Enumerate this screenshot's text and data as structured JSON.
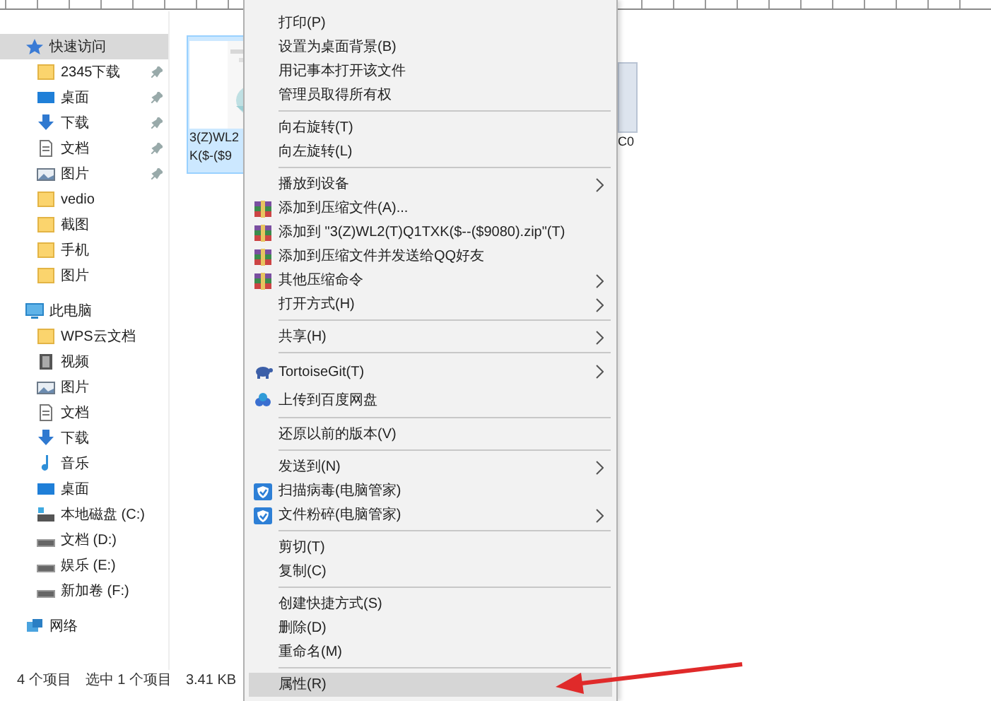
{
  "sidebar": {
    "items": [
      {
        "label": "快速访问",
        "kind": "star",
        "selected": true,
        "children": [
          {
            "label": "2345下载",
            "kind": "folder",
            "selected": false,
            "pinned": true
          },
          {
            "label": "桌面",
            "kind": "desktop",
            "selected": false,
            "pinned": true
          },
          {
            "label": "下载",
            "kind": "download",
            "selected": false,
            "pinned": true
          },
          {
            "label": "文档",
            "kind": "document",
            "selected": false,
            "pinned": true
          },
          {
            "label": "图片",
            "kind": "pictures",
            "selected": false,
            "pinned": true
          },
          {
            "label": "vedio",
            "kind": "folder",
            "selected": false,
            "pinned": false
          },
          {
            "label": "截图",
            "kind": "folder",
            "selected": false,
            "pinned": false
          },
          {
            "label": "手机",
            "kind": "folder",
            "selected": false,
            "pinned": false
          },
          {
            "label": "图片",
            "kind": "folder",
            "selected": false,
            "pinned": false
          }
        ]
      },
      {
        "label": "此电脑",
        "kind": "pc",
        "selected": false,
        "children": [
          {
            "label": "WPS云文档",
            "kind": "folder",
            "selected": false,
            "pinned": false
          },
          {
            "label": "视频",
            "kind": "video",
            "selected": false,
            "pinned": false
          },
          {
            "label": "图片",
            "kind": "pictures",
            "selected": false,
            "pinned": false
          },
          {
            "label": "文档",
            "kind": "document",
            "selected": false,
            "pinned": false
          },
          {
            "label": "下载",
            "kind": "download",
            "selected": false,
            "pinned": false
          },
          {
            "label": "音乐",
            "kind": "music",
            "selected": false,
            "pinned": false
          },
          {
            "label": "桌面",
            "kind": "desktop",
            "selected": false,
            "pinned": false
          },
          {
            "label": "本地磁盘 (C:)",
            "kind": "system-drive",
            "selected": false,
            "pinned": false
          },
          {
            "label": "文档 (D:)",
            "kind": "drive",
            "selected": false,
            "pinned": false
          },
          {
            "label": "娱乐 (E:)",
            "kind": "drive",
            "selected": false,
            "pinned": false
          },
          {
            "label": "新加卷 (F:)",
            "kind": "drive",
            "selected": false,
            "pinned": false
          }
        ]
      },
      {
        "label": "网络",
        "kind": "network",
        "selected": false
      }
    ]
  },
  "files": [
    {
      "lines": [
        "3(Z)WL2",
        "K($-($9"
      ],
      "selected": true
    },
    {
      "lines": [
        "C0"
      ],
      "selected": false
    }
  ],
  "status_bar": {
    "item_count": "4 个项目",
    "selection": "选中 1 个项目",
    "size": "3.41 KB"
  },
  "context_menu": {
    "groups": [
      {
        "items": [
          {
            "label": "打印(P)",
            "submenu": false,
            "selected": false
          },
          {
            "label": "设置为桌面背景(B)",
            "submenu": false,
            "selected": false
          },
          {
            "label": "用记事本打开该文件",
            "submenu": false,
            "selected": false
          },
          {
            "label": "管理员取得所有权",
            "submenu": false,
            "selected": false
          }
        ]
      },
      {
        "items": [
          {
            "label": "向右旋转(T)",
            "submenu": false,
            "selected": false
          },
          {
            "label": "向左旋转(L)",
            "submenu": false,
            "selected": false
          }
        ]
      },
      {
        "items": [
          {
            "label": "播放到设备",
            "submenu": true,
            "selected": false
          },
          {
            "label": "添加到压缩文件(A)...",
            "kind": "archive",
            "submenu": false,
            "selected": false
          },
          {
            "label": "添加到 \"3(Z)WL2(T)Q1TXK($--($9080).zip\"(T)",
            "kind": "archive",
            "submenu": false,
            "selected": false
          },
          {
            "label": "添加到压缩文件并发送给QQ好友",
            "kind": "archive",
            "submenu": false,
            "selected": false
          },
          {
            "label": "其他压缩命令",
            "kind": "archive",
            "submenu": true,
            "selected": false
          },
          {
            "label": "打开方式(H)",
            "submenu": true,
            "selected": false
          }
        ]
      },
      {
        "items": [
          {
            "label": "共享(H)",
            "submenu": true,
            "selected": false
          }
        ]
      },
      {
        "items": [
          {
            "label": "TortoiseGit(T)",
            "kind": "tortoise",
            "submenu": true,
            "selected": false
          },
          {
            "label": "上传到百度网盘",
            "kind": "cloud",
            "submenu": false,
            "selected": false
          }
        ]
      },
      {
        "items": [
          {
            "label": "还原以前的版本(V)",
            "submenu": false,
            "selected": false
          }
        ]
      },
      {
        "items": [
          {
            "label": "发送到(N)",
            "submenu": true,
            "selected": false
          },
          {
            "label": "扫描病毒(电脑管家)",
            "kind": "shield",
            "submenu": false,
            "selected": false
          },
          {
            "label": "文件粉碎(电脑管家)",
            "kind": "shield",
            "submenu": true,
            "selected": false
          }
        ]
      },
      {
        "items": [
          {
            "label": "剪切(T)",
            "submenu": false,
            "selected": false
          },
          {
            "label": "复制(C)",
            "submenu": false,
            "selected": false
          }
        ]
      },
      {
        "items": [
          {
            "label": "创建快捷方式(S)",
            "submenu": false,
            "selected": false
          },
          {
            "label": "删除(D)",
            "submenu": false,
            "selected": false
          },
          {
            "label": "重命名(M)",
            "submenu": false,
            "selected": false
          }
        ]
      },
      {
        "items": [
          {
            "label": "属性(R)",
            "submenu": false,
            "selected": true
          }
        ]
      }
    ]
  }
}
